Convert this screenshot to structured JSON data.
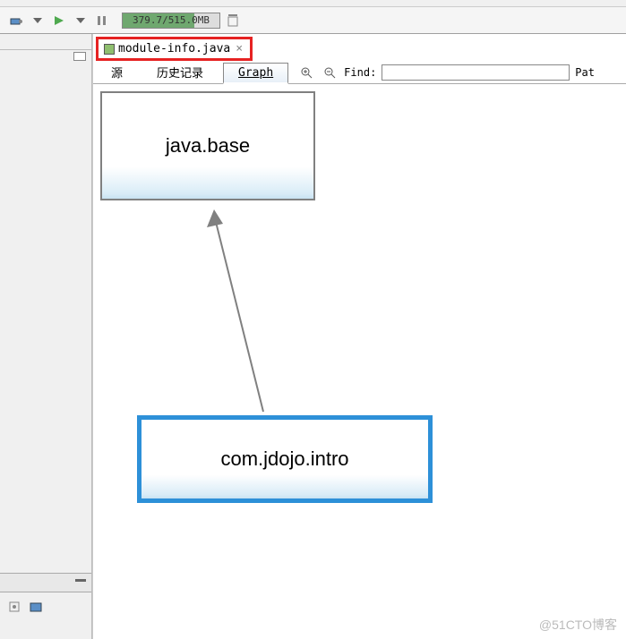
{
  "toolbar": {
    "memory_text": "379.7/515.0MB"
  },
  "tab": {
    "filename": "module-info.java"
  },
  "subtabs": {
    "source": "源",
    "history": "历史记录",
    "graph": "Graph"
  },
  "find": {
    "label": "Find:",
    "placeholder": "",
    "trailing": "Pat"
  },
  "graph": {
    "base_node": "java.base",
    "intro_node": "com.jdojo.intro"
  },
  "watermark": "@51CTO博客",
  "icons": {
    "debug": "debug-icon",
    "run": "run-icon",
    "save": "save-icon",
    "pause": "pause-icon",
    "gc": "gc-icon",
    "zoom_in": "zoom-in-icon",
    "zoom_out": "zoom-out-icon",
    "minimize": "minimize-icon",
    "tab_file": "java-file-icon"
  }
}
